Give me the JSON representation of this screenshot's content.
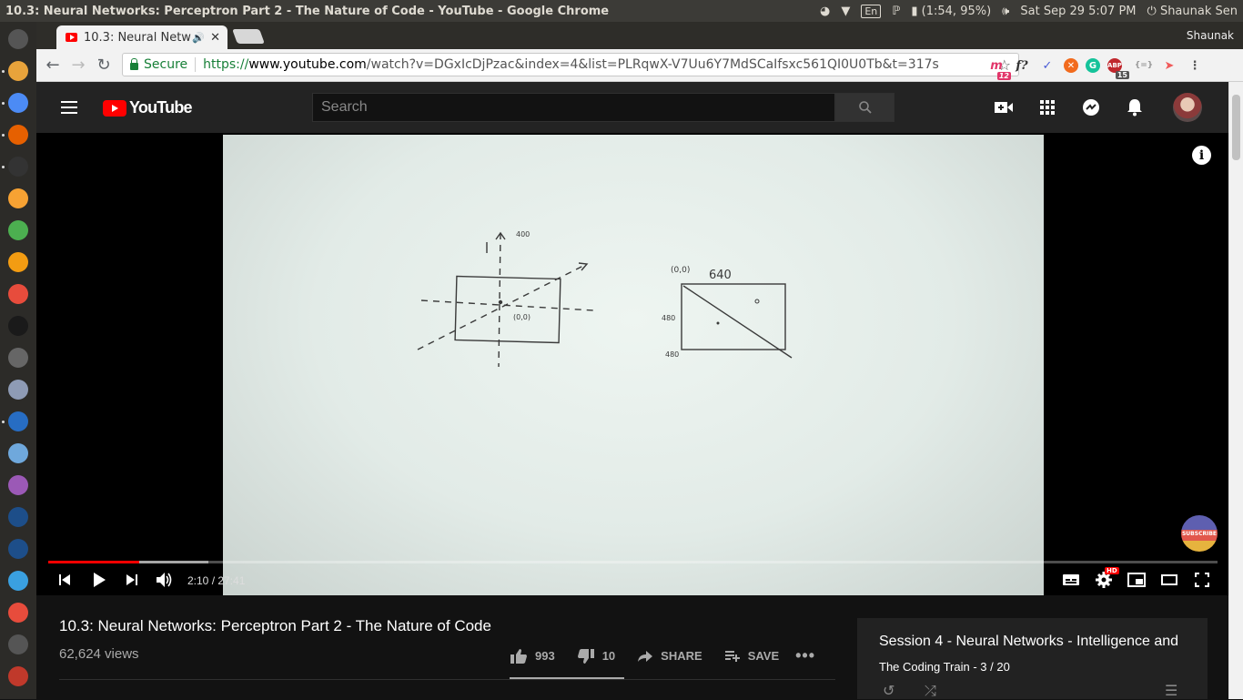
{
  "os": {
    "window_title": "10.3: Neural Networks: Perceptron Part 2 - The Nature of Code - YouTube - Google Chrome",
    "keyboard": "En",
    "battery": "(1:54, 95%)",
    "datetime": "Sat Sep 29  5:07 PM",
    "user": "Shaunak Sen"
  },
  "launcher": {
    "icons": [
      "unity-home-icon",
      "files-icon",
      "chrome-icon",
      "firefox-icon",
      "terminal-icon",
      "app-icon",
      "settings-icon",
      "vlc-icon",
      "screen-recorder-icon",
      "webstorm-icon",
      "database-icon",
      "atom-icon",
      "rstudio-icon",
      "weather-icon",
      "text-editor-icon",
      "pycharm-icon",
      "pycharm-icon-2",
      "calculator-icon",
      "disk-icon",
      "usb-icon",
      "trash-icon"
    ]
  },
  "browser": {
    "tab_title": "10.3: Neural Netw",
    "profile": "Shaunak",
    "secure_label": "Secure",
    "url_scheme": "https://",
    "url_host": "www.youtube.com",
    "url_rest": "/watch?v=DGxIcDjPzac&index=4&list=PLRqwX-V7Uu6Y7MdSCaIfsxc561QI0U0Tb&t=317s",
    "ext_badges": [
      "12",
      "15"
    ]
  },
  "youtube": {
    "logo_text": "YouTube",
    "search_placeholder": "Search",
    "video_title": "10.3: Neural Networks: Perceptron Part 2 - The Nature of Code",
    "views": "62,624 views",
    "likes": "993",
    "dislikes": "10",
    "share_label": "SHARE",
    "save_label": "SAVE",
    "subscribe_badge": "SUBSCRIBE",
    "time_display": "2:10 / 27:41",
    "progress_played_fraction": 0.078,
    "progress_loaded_fraction": 0.137,
    "hd_badge": "HD",
    "playlist": {
      "title": "Session 4 - Neural Networks - Intelligence and",
      "subtitle": "The Coding Train - 3 / 20"
    }
  },
  "whiteboard": {
    "labels": [
      "400",
      "(0,0)",
      "(0,0)",
      "640",
      "480",
      "480"
    ]
  }
}
